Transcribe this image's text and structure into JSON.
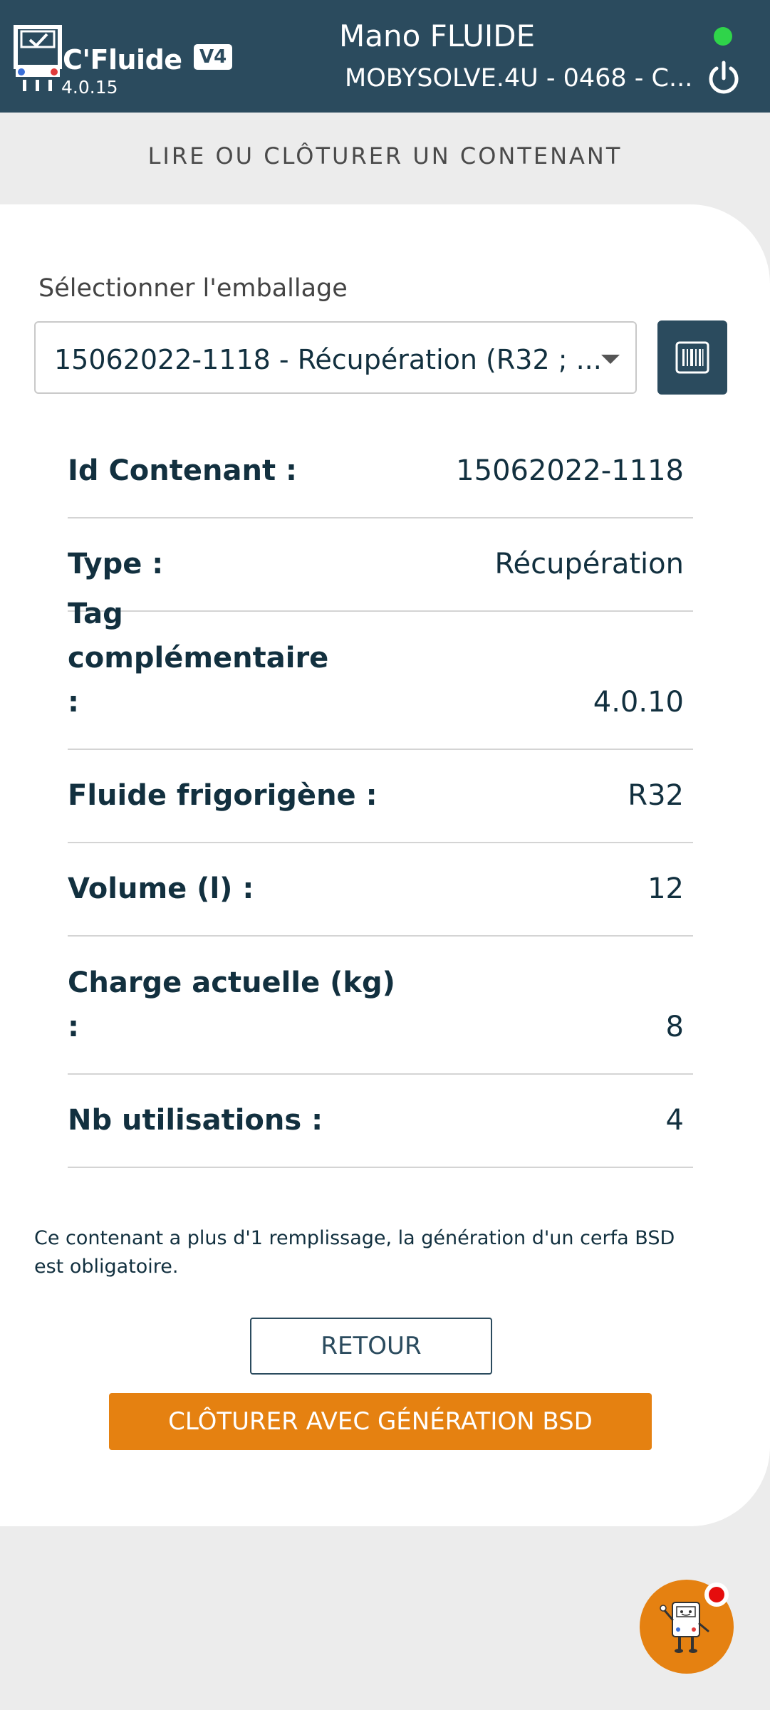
{
  "header": {
    "brand": "C'Fluide",
    "badge": "V4",
    "version": "4.0.15",
    "title": "Mano FLUIDE",
    "subtitle": "MOBYSOLVE.4U - 0468 - C...",
    "status_color": "#2fd44a"
  },
  "page": {
    "heading": "LIRE OU CLÔTURER UN CONTENANT"
  },
  "form": {
    "select_label": "Sélectionner l'emballage",
    "select_value": "15062022-1118 - Récupération (R32 ; ...",
    "scan_icon": "barcode-icon"
  },
  "details": [
    {
      "label": "Id Contenant :",
      "value": "15062022-1118"
    },
    {
      "label": "Type :",
      "value": "Récupération"
    },
    {
      "label": "Tag complémentaire :",
      "value": "4.0.10"
    },
    {
      "label": "Fluide frigorigène :",
      "value": "R32"
    },
    {
      "label": "Volume (l) :",
      "value": "12"
    },
    {
      "label": "Charge actuelle (kg) :",
      "value": "8"
    },
    {
      "label": "Nb utilisations :",
      "value": "4"
    }
  ],
  "note": "Ce contenant a plus d'1 remplissage, la génération d'un cerfa BSD est obligatoire.",
  "buttons": {
    "back": "RETOUR",
    "close": "CLÔTURER AVEC GÉNÉRATION BSD"
  },
  "colors": {
    "header_bg": "#2b4b5e",
    "accent": "#e58111",
    "notification": "#e50d0d"
  }
}
